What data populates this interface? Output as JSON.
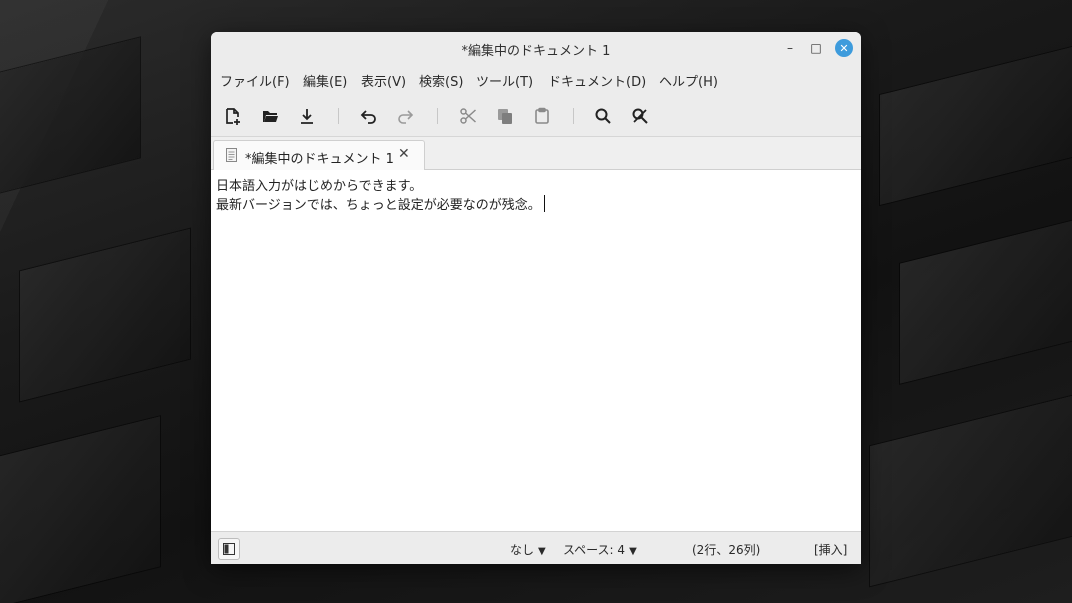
{
  "window": {
    "title": "*編集中のドキュメント 1",
    "minimize_glyph": "–",
    "maximize_glyph": "□",
    "close_glyph": "✕"
  },
  "menubar": {
    "items": [
      "ファイル(F)",
      "編集(E)",
      "表示(V)",
      "検索(S)",
      "ツール(T)",
      "ドキュメント(D)",
      "ヘルプ(H)"
    ]
  },
  "toolbar": {
    "buttons": [
      "new-document-icon",
      "open-document-icon",
      "save-icon",
      "undo-icon",
      "redo-icon",
      "cut-icon",
      "copy-icon",
      "paste-icon",
      "search-icon",
      "replace-icon"
    ]
  },
  "tab": {
    "label": "*編集中のドキュメント 1",
    "close_glyph": "✕"
  },
  "editor": {
    "lines": [
      "日本語入力がはじめからできます。",
      "最新バージョンでは、ちょっと設定が必要なのが残念。"
    ]
  },
  "status": {
    "syntax": "なし",
    "indent": "スペース: 4",
    "position": "(2行、26列)",
    "mode": "[挿入]"
  },
  "colors": {
    "close_button": "#3d9bdc",
    "chrome": "#ececec"
  }
}
